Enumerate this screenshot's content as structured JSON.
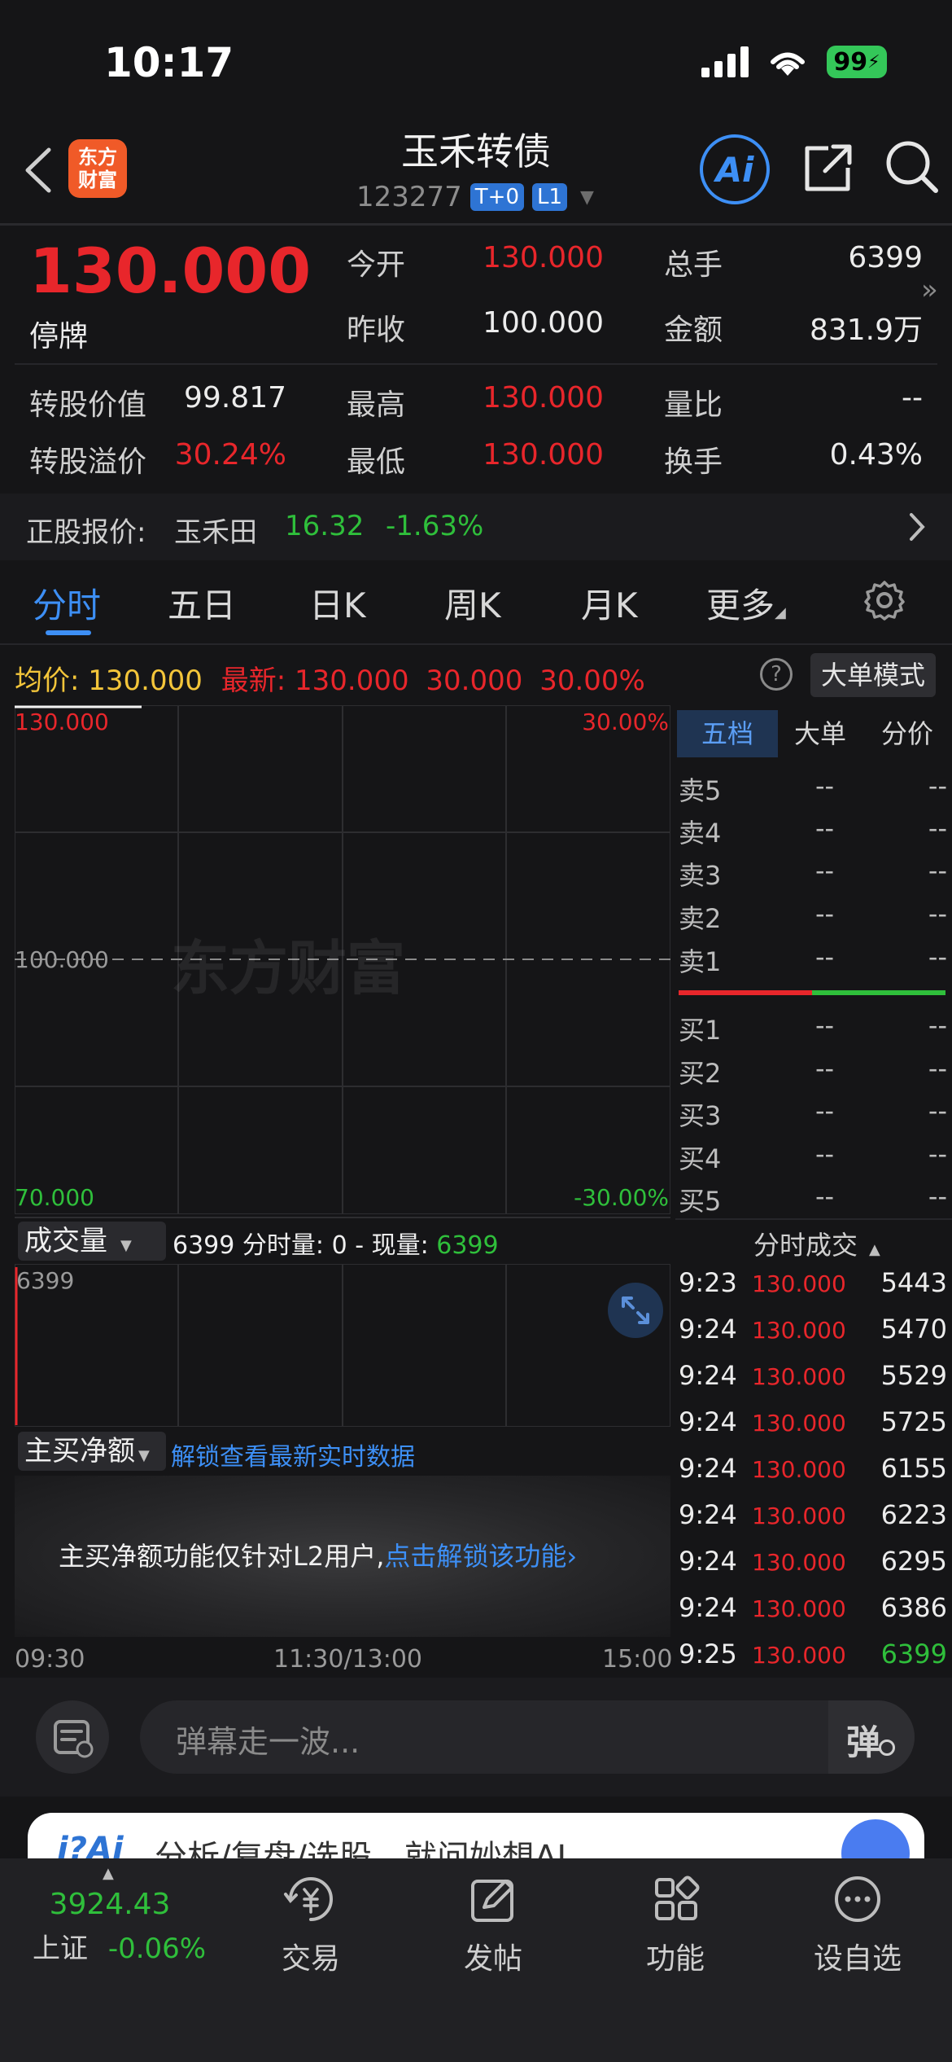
{
  "status": {
    "time": "10:17",
    "battery": "99"
  },
  "header": {
    "title": "玉禾转债",
    "code": "123277",
    "tag1": "T+0",
    "tag2": "L1",
    "logo_line1": "东方",
    "logo_line2": "财富",
    "ai_label": "Ai"
  },
  "quote": {
    "price": "130.000",
    "state": "停牌",
    "open_label": "今开",
    "open": "130.000",
    "prev_label": "昨收",
    "prev": "100.000",
    "vol_label": "总手",
    "vol": "6399",
    "amount_label": "金额",
    "amount": "831.9万",
    "conv_value_label": "转股价值",
    "conv_value": "99.817",
    "high_label": "最高",
    "high": "130.000",
    "ratio_label": "量比",
    "ratio": "--",
    "premium_label": "转股溢价",
    "premium": "30.24%",
    "low_label": "最低",
    "low": "130.000",
    "turnover_label": "换手",
    "turnover": "0.43%"
  },
  "stock": {
    "label": "正股报价:",
    "name": "玉禾田",
    "price": "16.32",
    "change": "-1.63%"
  },
  "tabs": [
    "分时",
    "五日",
    "日K",
    "周K",
    "月K",
    "更多"
  ],
  "chart_info": {
    "avg_label": "均价:",
    "avg": "130.000",
    "latest_label": "最新:",
    "latest": "130.000",
    "chg": "30.000",
    "pct": "30.00%",
    "help": "?",
    "mode_btn": "大单模式",
    "y_top": "130.000",
    "y_mid": "100.000",
    "y_bot": "70.000",
    "pct_top": "30.00%",
    "pct_bot": "-30.00%",
    "watermark": "东方财富"
  },
  "volume": {
    "select": "成交量",
    "total": "6399",
    "fen_label": "分时量:",
    "fen": "0",
    "sep": "-",
    "now_label": "现量:",
    "now": "6399",
    "axis_max": "6399"
  },
  "mainbuy": {
    "select": "主买净额",
    "unlock_link": "解锁查看最新实时数据",
    "notice": "主买净额功能仅针对L2用户,",
    "notice_link": "点击解锁该功能"
  },
  "time_axis": [
    "09:30",
    "11:30/13:00",
    "15:00"
  ],
  "panel": {
    "tabs": [
      "五档",
      "大单",
      "分价"
    ],
    "sells": [
      "卖5",
      "卖4",
      "卖3",
      "卖2",
      "卖1"
    ],
    "buys": [
      "买1",
      "买2",
      "买3",
      "买4",
      "买5"
    ],
    "empty": "--",
    "trades_title": "分时成交",
    "trades": [
      {
        "t": "9:23",
        "p": "130.000",
        "v": "5443"
      },
      {
        "t": "9:24",
        "p": "130.000",
        "v": "5470"
      },
      {
        "t": "9:24",
        "p": "130.000",
        "v": "5529"
      },
      {
        "t": "9:24",
        "p": "130.000",
        "v": "5725"
      },
      {
        "t": "9:24",
        "p": "130.000",
        "v": "6155"
      },
      {
        "t": "9:24",
        "p": "130.000",
        "v": "6223"
      },
      {
        "t": "9:24",
        "p": "130.000",
        "v": "6295"
      },
      {
        "t": "9:24",
        "p": "130.000",
        "v": "6386"
      },
      {
        "t": "9:25",
        "p": "130.000",
        "v": "6399"
      }
    ]
  },
  "danmu": {
    "placeholder": "弹幕走一波...",
    "btn": "弹"
  },
  "ad": {
    "text": "分析/复盘/选股，就问妙想AI"
  },
  "bottom_nav": {
    "index_value": "3924.43",
    "index_name": "上证",
    "index_change": "-0.06%",
    "items": [
      "交易",
      "发帖",
      "功能",
      "设自选"
    ]
  }
}
